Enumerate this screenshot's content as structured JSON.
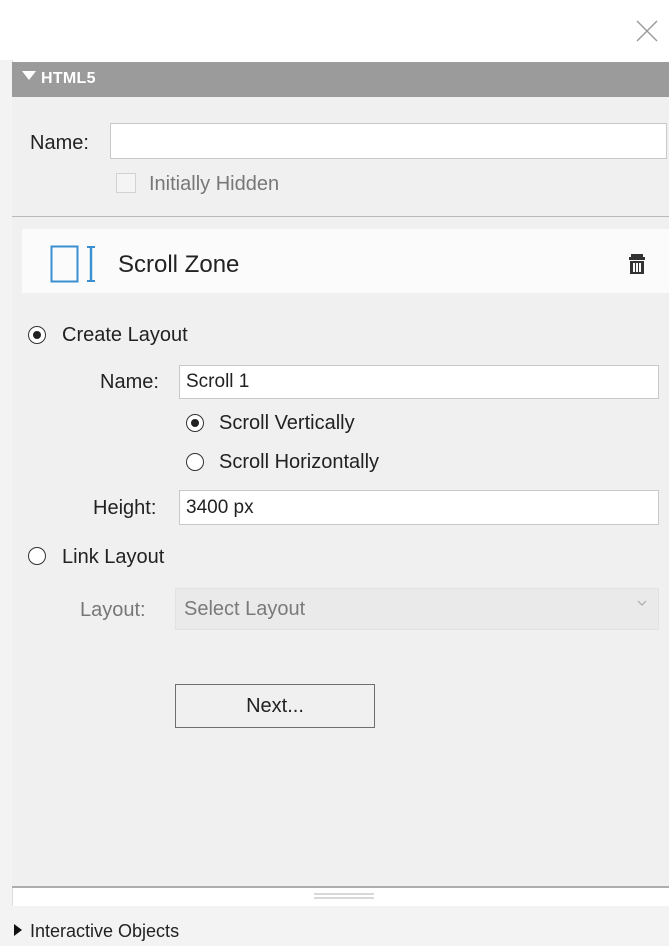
{
  "window": {
    "close_icon": "close-icon"
  },
  "section_header": {
    "title": "HTML5",
    "icon": "triangle-down-icon"
  },
  "element_props": {
    "name_label": "Name:",
    "name_value": "",
    "initially_hidden_label": "Initially Hidden",
    "initially_hidden_checked": false
  },
  "scroll_zone": {
    "title": "Scroll Zone",
    "icon": "scroll-zone-icon",
    "delete_icon": "trash-icon"
  },
  "create_layout": {
    "label": "Create Layout",
    "selected": true,
    "name_label": "Name:",
    "name_value": "Scroll 1",
    "scroll_vertically_label": "Scroll Vertically",
    "scroll_vertically_selected": true,
    "scroll_horizontally_label": "Scroll Horizontally",
    "scroll_horizontally_selected": false,
    "height_label": "Height:",
    "height_value": "3400 px"
  },
  "link_layout": {
    "label": "Link Layout",
    "selected": false,
    "layout_label": "Layout:",
    "layout_value": "Select Layout"
  },
  "next_button": "Next...",
  "footer": {
    "label": "Interactive Objects",
    "icon": "triangle-right-icon"
  },
  "colors": {
    "header_bg": "#9b9b9b",
    "panel_bg": "#f0f0f0",
    "accent": "#3a8fd0"
  }
}
